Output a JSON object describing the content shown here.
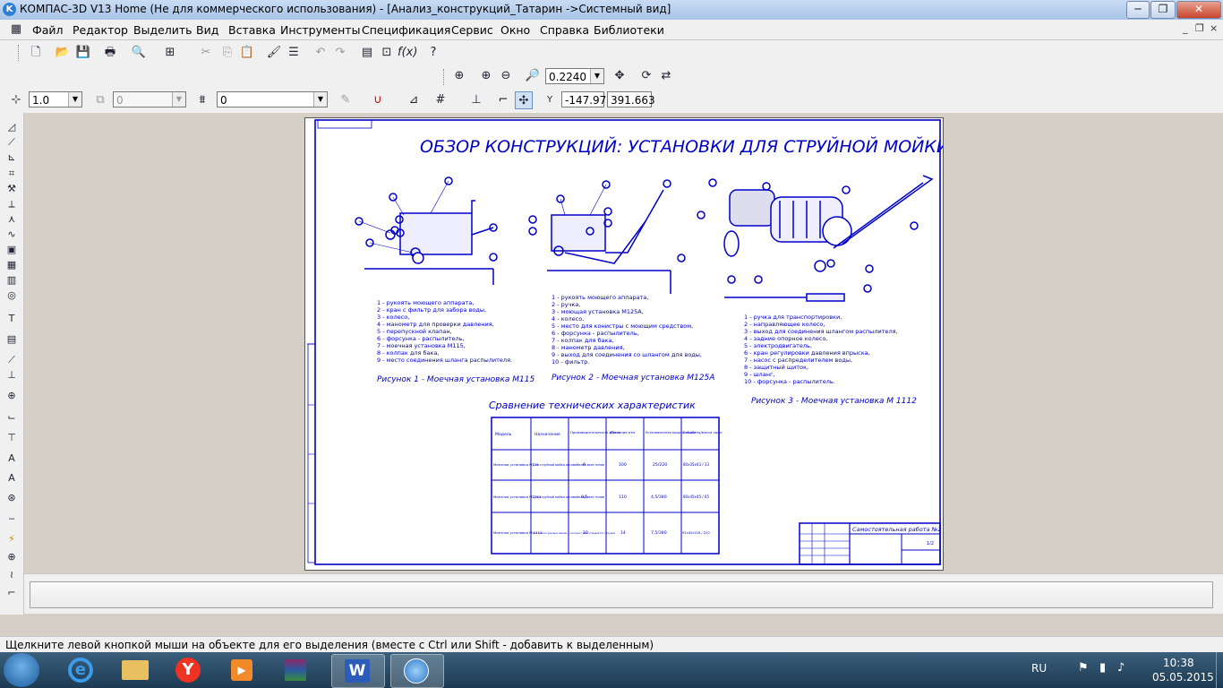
{
  "window": {
    "title": "КОМПАС-3D V13 Home (Не для коммерческого использования) - [Анализ_конструкций_Татарин ->Системный вид]",
    "minimize": "─",
    "restore": "❐",
    "close": "✕"
  },
  "menu": [
    "Файл",
    "Редактор",
    "Выделить",
    "Вид",
    "Вставка",
    "Инструменты",
    "Спецификация",
    "Сервис",
    "Окно",
    "Справка",
    "Библиотеки"
  ],
  "mdi": {
    "minimize": "_",
    "restore": "❐",
    "close": "×"
  },
  "toolbar_view": {
    "zoom": "0.2240"
  },
  "toolbar_current": {
    "line_scale": "1.0",
    "layer_state": "0",
    "layer": "0",
    "coord_x": "-147.97",
    "coord_y": "391.663",
    "coord_label": "Y"
  },
  "status_text": "Щелкните левой кнопкой мыши на объекте для его выделения (вместе с Ctrl или Shift - добавить к выделенным)",
  "tray": {
    "lang": "RU",
    "time": "10:38",
    "date": "05.05.2015"
  },
  "drawing": {
    "title": "ОБЗОР КОНСТРУКЦИЙ: УСТАНОВКИ ДЛЯ СТРУЙНОЙ МОЙКИ",
    "list1": [
      "1 - рукоять моющего аппарата,",
      "2 - кран с фильтр для забора воды,",
      "3 - колесо,",
      "4 - манометр для проверки давления,",
      "5 - перепускной клапан,",
      "6 - форсунка - распылитель,",
      "7 - моечная установка М115,",
      "8 - колпак для бака,",
      "9 - место соединения шланга распылителя."
    ],
    "caption1": "Рисунок 1 - Моечная установка М115",
    "list2": [
      "1 - рукоять моющего аппарата,",
      "2 - ручка,",
      "3 - моющая установка М125А,",
      "4 - колесо,",
      "5 - место для конистры с моющим средством,",
      "6 - форсунка - распылитель,",
      "7 - колпак для бака,",
      "8 - манометр давления,",
      "9 - выход для соединения со шлангом для воды,",
      "10 - фильтр."
    ],
    "caption2": "Рисунок 2 - Моечная установка М125А",
    "list3": [
      "1 - ручка для транспортировки,",
      "2 - направляющее колесо,",
      "3 - выход для соединения шлангом распылителя,",
      "4 - задние опорное колесо,",
      "5 - электродвигатель,",
      "6 - кран регулировки давления впрыска,",
      "7 - насос с распределителем воды,",
      "8 - защитный щиток,",
      "9 - шланг,",
      "10 - форсунка - распылитель."
    ],
    "caption3": "Рисунок 3 - Моечная установка М 1112",
    "table_title": "Сравнение технических характеристик",
    "table": {
      "headers": [
        "Модель",
        "Назначение",
        "Производительность м³/час",
        "Давление атм",
        "Установленная мощность кВт",
        "Габариты/масса см/кг"
      ],
      "rows": [
        [
          "Моечная установка М115",
          "Для струйной мойки автомобилей всех типов",
          "6",
          "100",
          "25/220",
          "80х35х43 / 33"
        ],
        [
          "Моечная установка М125А",
          "Для струйной мойки автомобилей всех типов",
          "0,5",
          "110",
          "4,5/380",
          "80х45х45 / 65"
        ],
        [
          "Моечная установка М 1112",
          "Для мойки грузовых машин, с которых грязь отмывается с трудом",
          "10",
          "14",
          "7,5/380",
          "92х42х118 / 220"
        ]
      ]
    },
    "stamp_title": "Самостоятельная работа №2",
    "stamp_sheet": "1/2"
  }
}
